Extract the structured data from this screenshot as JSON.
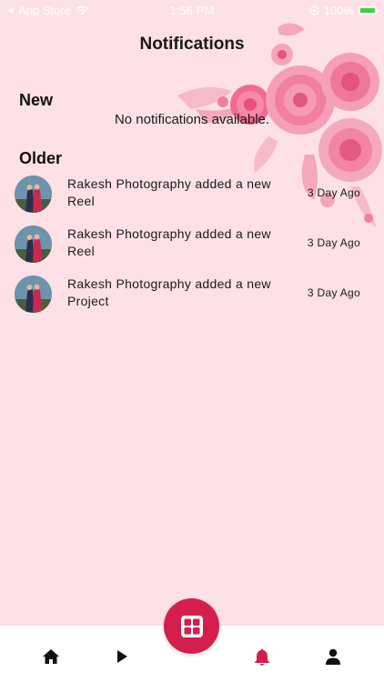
{
  "status_bar": {
    "carrier": "App Store",
    "time": "1:56 PM",
    "battery": "100%"
  },
  "page": {
    "title": "Notifications"
  },
  "sections": {
    "new": {
      "label": "New",
      "empty_message": "No notifications available."
    },
    "older": {
      "label": "Older",
      "items": [
        {
          "text": "Rakesh Photography added a new Reel",
          "time": "3 Day Ago"
        },
        {
          "text": "Rakesh Photography added a new Reel",
          "time": "3 Day Ago"
        },
        {
          "text": "Rakesh Photography added a new Project",
          "time": "3 Day Ago"
        }
      ]
    }
  },
  "bottom_nav": {
    "items": [
      {
        "icon": "home-icon"
      },
      {
        "icon": "play-icon"
      },
      {
        "icon": "grid-icon"
      },
      {
        "icon": "bell-icon"
      },
      {
        "icon": "user-icon"
      }
    ],
    "active": "bell-icon"
  },
  "colors": {
    "background": "#fde1e6",
    "accent": "#d41e4c",
    "nav_background": "#ffffff"
  }
}
